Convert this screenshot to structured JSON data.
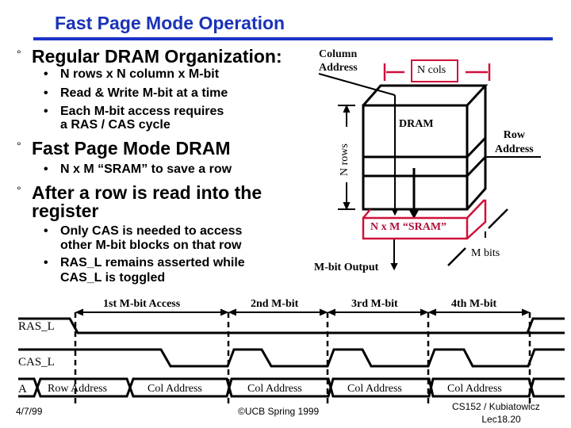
{
  "slide": {
    "title": "Fast Page Mode Operation",
    "footer_date": "4/7/99",
    "footer_copyright": "©UCB Spring 1999",
    "footer_course": "CS152 / Kubiatowicz",
    "footer_lecture": "Lec18.20"
  },
  "bullets": [
    {
      "text": "Regular DRAM Organization:",
      "sub": [
        "N rows x N column x M-bit",
        "Read & Write M-bit at a time",
        "Each M-bit access requires",
        "a RAS / CAS cycle"
      ]
    },
    {
      "text": "Fast Page Mode DRAM",
      "sub": [
        "N x M “SRAM” to save a row"
      ]
    },
    {
      "text_line1": "After a row is read into the",
      "text_line2": "register",
      "sub": [
        "Only CAS is needed to access",
        "other M-bit blocks on that row",
        "RAS_L remains asserted while",
        "CAS_L is toggled"
      ]
    }
  ],
  "bullet_glyph": "°",
  "sub_bullet_glyph": "•",
  "dram_figure": {
    "column_address_line1": "Column",
    "column_address_line2": "Address",
    "n_cols": "N cols",
    "dram_label": "DRAM",
    "n_rows": "N rows",
    "row_address_line1": "Row",
    "row_address_line2": "Address",
    "sram_label": "N x M “SRAM”",
    "m_bits": "M bits",
    "output_label": "M-bit Output"
  },
  "timing": {
    "intervals": [
      "1st M-bit Access",
      "2nd M-bit",
      "3rd M-bit",
      "4th M-bit"
    ],
    "signals": [
      "RAS_L",
      "CAS_L",
      "A"
    ],
    "address_values": [
      "Row Address",
      "Col Address",
      "Col Address",
      "Col Address",
      "Col Address"
    ]
  },
  "colors": {
    "title": "#1a33b8",
    "accent_red": "#d0103a",
    "sram_text": "#b0103a"
  }
}
